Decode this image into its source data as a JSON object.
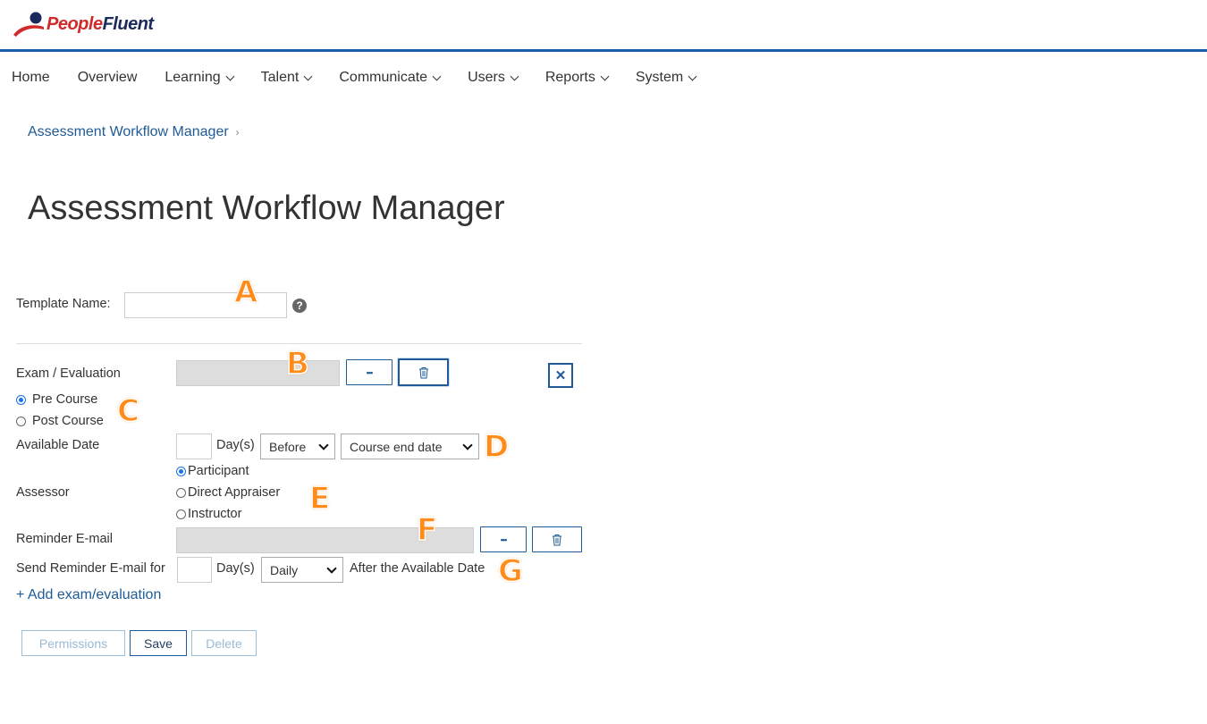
{
  "brand": {
    "people": "People",
    "fluent": "Fluent"
  },
  "nav": [
    {
      "label": "Home",
      "dropdown": false
    },
    {
      "label": "Overview",
      "dropdown": false
    },
    {
      "label": "Learning",
      "dropdown": true
    },
    {
      "label": "Talent",
      "dropdown": true
    },
    {
      "label": "Communicate",
      "dropdown": true
    },
    {
      "label": "Users",
      "dropdown": true
    },
    {
      "label": "Reports",
      "dropdown": true
    },
    {
      "label": "System",
      "dropdown": true
    }
  ],
  "breadcrumb": {
    "label": "Assessment Workflow Manager",
    "sep": "›"
  },
  "page_title": "Assessment Workflow Manager",
  "form": {
    "template_name_label": "Template Name:",
    "template_name_value": "",
    "help": "?",
    "exam_label": "Exam / Evaluation",
    "browse": "•••",
    "pre_course": "Pre Course",
    "post_course": "Post Course",
    "available_date_label": "Available Date",
    "days_label": "Day(s)",
    "before_value": "Before",
    "course_end_value": "Course end date",
    "assessor_label": "Assessor",
    "participant": "Participant",
    "direct_appraiser": "Direct Appraiser",
    "instructor": "Instructor",
    "reminder_label": "Reminder E-mail",
    "send_reminder_label": "Send Reminder E-mail for",
    "daily_value": "Daily",
    "after_available": "After the Available Date",
    "add_link": "+ Add exam/evaluation",
    "close": "✕"
  },
  "buttons": {
    "permissions": "Permissions",
    "save": "Save",
    "delete": "Delete"
  },
  "markers": {
    "a": "A",
    "b": "B",
    "c": "C",
    "d": "D",
    "e": "E",
    "f": "F",
    "g": "G"
  },
  "colors": {
    "accent": "#1f5b96",
    "topbar": "#1a5ea8",
    "marker": "#ff8c1a",
    "brand_red": "#d02a2a"
  }
}
